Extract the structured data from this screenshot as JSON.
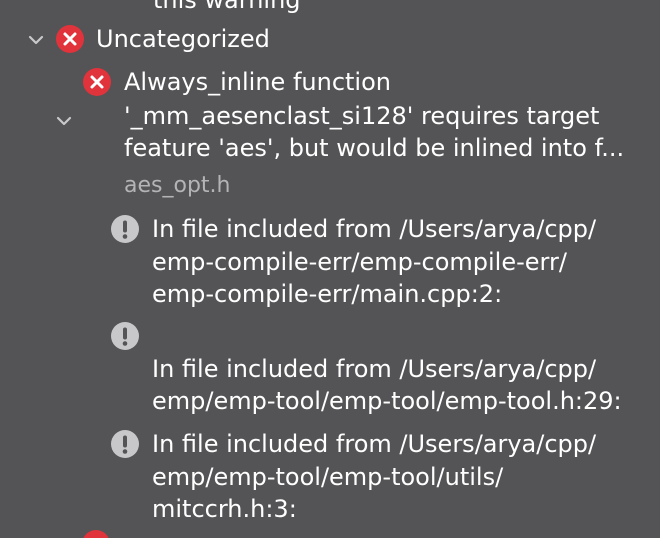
{
  "issue_navigator": {
    "prev_item_tail": "this warning",
    "group": {
      "title": "Uncategorized",
      "status_color": "#e0333b"
    },
    "error": {
      "message_lines": [
        "Always_inline function",
        "'_mm_aesenclast_si128' requires target",
        "feature 'aes', but would be inlined into f..."
      ],
      "file": "aes_opt.h"
    },
    "notes": [
      {
        "lines": [
          "In file included from /Users/arya/cpp/",
          "emp-compile-err/emp-compile-err/",
          "emp-compile-err/main.cpp:2:"
        ]
      },
      {
        "lines": [
          "",
          "In file included from /Users/arya/cpp/",
          "emp/emp-tool/emp-tool/emp-tool.h:29:"
        ]
      },
      {
        "lines": [
          "In file included from /Users/arya/cpp/",
          "emp/emp-tool/emp-tool/utils/",
          "mitccrh.h:3:"
        ]
      }
    ],
    "icons": {
      "group_chevron": "chevron-down-icon",
      "error": "error-x-icon",
      "note": "exclamation-icon"
    }
  }
}
